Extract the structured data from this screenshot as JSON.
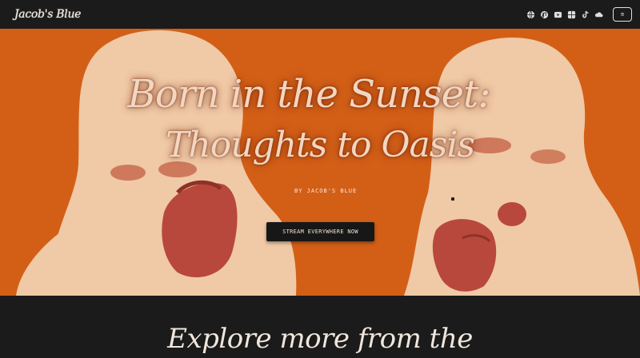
{
  "brand": {
    "logo_text": "Jacob's Blue"
  },
  "nav": {
    "icons": [
      "globe-icon",
      "music-icon",
      "play-icon",
      "grid-icon",
      "social-icon",
      "cloud-icon"
    ],
    "menu_label": "≡"
  },
  "hero": {
    "title_line1": "Born in  the Sunset:",
    "title_line2": "Thoughts to Oasis",
    "byline": "BY JACOB'S BLUE",
    "cta_label": "STREAM EVERYWHERE NOW",
    "colors": {
      "background": "#d35f17",
      "figure": "#f0c9a6",
      "skin": "#b8483b"
    }
  },
  "section": {
    "explore_heading": "Explore more from the"
  }
}
